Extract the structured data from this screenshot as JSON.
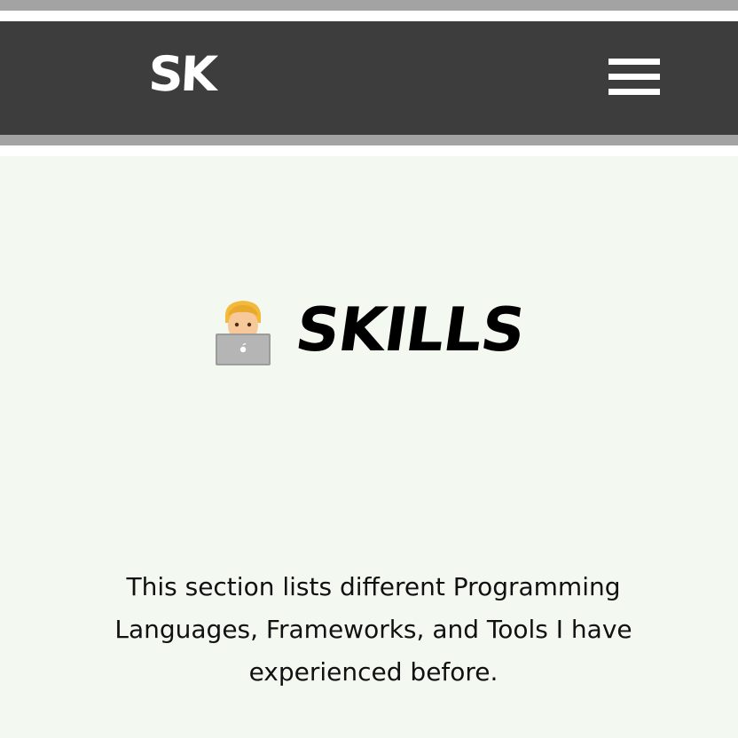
{
  "navbar": {
    "logo_text": "SK",
    "menu_icon": "hamburger-menu-icon"
  },
  "skills": {
    "icon": "technologist-emoji-icon",
    "title": "SKILLS",
    "description": "This section lists different Programming Languages, Frameworks, and Tools I have experienced before."
  },
  "colors": {
    "stripe": "#a3a3a3",
    "navbar_bg": "#3d3d3d",
    "section_bg": "#f3f9f1",
    "text": "#000000"
  }
}
